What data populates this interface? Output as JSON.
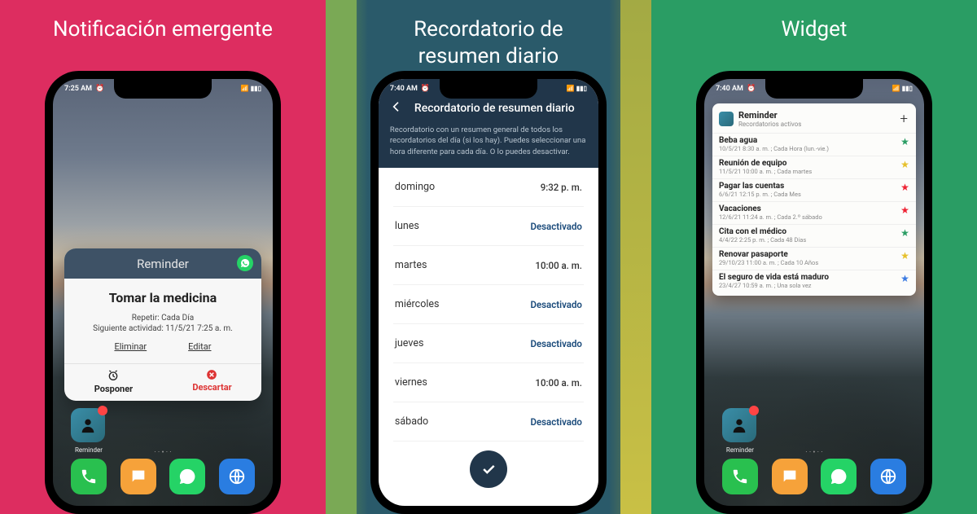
{
  "panels": {
    "p1": {
      "title": "Notificación emergente"
    },
    "p2": {
      "title": "Recordatorio de\nresumen diario"
    },
    "p3": {
      "title": "Widget"
    }
  },
  "status": {
    "time1": "7:25 AM",
    "time2": "7:40 AM",
    "time3": "7:40 AM",
    "alarm": "⏰"
  },
  "popup": {
    "app": "Reminder",
    "title": "Tomar la medicina",
    "repeat_lbl": "Repetir:",
    "repeat_val": "Cada Día",
    "next_lbl": "Siguiente actividad:",
    "next_val": "11/5/21  7:25 a. m.",
    "delete": "Eliminar",
    "edit": "Editar",
    "snooze": "Posponer",
    "dismiss": "Descartar"
  },
  "appicon": {
    "label": "Reminder"
  },
  "settings": {
    "title": "Recordatorio de resumen diario",
    "desc": "Recordatorio con un resumen general de todos los recordatorios del día (si los hay). Puedes seleccionar una hora diferente para cada día. O lo puedes desactivar.",
    "days": [
      {
        "name": "domingo",
        "val": "9:32 p. m.",
        "time": true
      },
      {
        "name": "lunes",
        "val": "Desactivado",
        "time": false
      },
      {
        "name": "martes",
        "val": "10:00 a. m.",
        "time": true
      },
      {
        "name": "miércoles",
        "val": "Desactivado",
        "time": false
      },
      {
        "name": "jueves",
        "val": "Desactivado",
        "time": false
      },
      {
        "name": "viernes",
        "val": "10:00 a. m.",
        "time": true
      },
      {
        "name": "sábado",
        "val": "Desactivado",
        "time": false
      }
    ]
  },
  "widget": {
    "title": "Reminder",
    "subtitle": "Recordatorios activos",
    "items": [
      {
        "name": "Beba agua",
        "meta": "10/5/21  8:30 a. m. ;  Cada Hora (lun.-vie.)",
        "star": "#2a9d64"
      },
      {
        "name": "Reunión de equipo",
        "meta": "11/5/21  10:00 a. m. ;  Cada martes",
        "star": "#e6c02a"
      },
      {
        "name": "Pagar las cuentas",
        "meta": "6/6/21  12:15 p. m. ;  Cada Mes",
        "star": "#e23"
      },
      {
        "name": "Vacaciones",
        "meta": "12/6/21  11:24 a. m. ;  Cada 2.º sábado",
        "star": "#e23"
      },
      {
        "name": "Cita con el médico",
        "meta": "4/4/22  2:25 p. m. ;  Cada 48 Días",
        "star": "#2a9d64"
      },
      {
        "name": "Renovar pasaporte",
        "meta": "29/10/23  11:00 a. m. ;  Cada 10 Años",
        "star": "#e6c02a"
      },
      {
        "name": "El seguro de vida está maduro",
        "meta": "23/4/27  10:59 a. m. ;  Una sola vez",
        "star": "#3a7ae2"
      }
    ]
  }
}
